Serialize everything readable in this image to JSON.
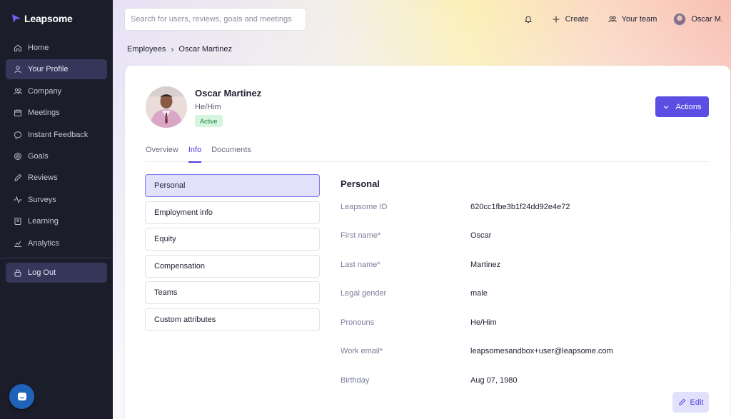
{
  "app": {
    "name": "Leapsome"
  },
  "sidebar": {
    "items": [
      {
        "label": "Home",
        "icon": "home-icon"
      },
      {
        "label": "Your Profile",
        "icon": "user-icon",
        "active": true
      },
      {
        "label": "Company",
        "icon": "users-icon"
      },
      {
        "label": "Meetings",
        "icon": "calendar-icon"
      },
      {
        "label": "Instant Feedback",
        "icon": "chat-bubble-icon"
      },
      {
        "label": "Goals",
        "icon": "target-icon"
      },
      {
        "label": "Reviews",
        "icon": "pen-icon"
      },
      {
        "label": "Surveys",
        "icon": "pulse-icon"
      },
      {
        "label": "Learning",
        "icon": "book-icon"
      },
      {
        "label": "Analytics",
        "icon": "chart-icon"
      }
    ],
    "logout": "Log Out"
  },
  "search": {
    "placeholder": "Search for users, reviews, goals and meetings"
  },
  "topbar": {
    "create": "Create",
    "team": "Your team",
    "user": "Oscar M."
  },
  "breadcrumb": {
    "parent": "Employees",
    "current": "Oscar Martinez"
  },
  "profile": {
    "name": "Oscar Martinez",
    "pronouns": "He/Him",
    "status": "Active",
    "actions_label": "Actions"
  },
  "tabs": [
    {
      "label": "Overview"
    },
    {
      "label": "Info",
      "active": true
    },
    {
      "label": "Documents"
    }
  ],
  "sections": [
    {
      "label": "Personal",
      "active": true
    },
    {
      "label": "Employment info"
    },
    {
      "label": "Equity"
    },
    {
      "label": "Compensation"
    },
    {
      "label": "Teams"
    },
    {
      "label": "Custom attributes"
    }
  ],
  "details": {
    "title": "Personal",
    "fields": [
      {
        "label": "Leapsome ID",
        "value": "620cc1fbe3b1f24dd92e4e72"
      },
      {
        "label": "First name*",
        "value": "Oscar"
      },
      {
        "label": "Last name*",
        "value": "Martinez"
      },
      {
        "label": "Legal gender",
        "value": "male"
      },
      {
        "label": "Pronouns",
        "value": "He/Him"
      },
      {
        "label": "Work email*",
        "value": "leapsomesandbox+user@leapsome.com"
      },
      {
        "label": "Birthday",
        "value": "Aug 07, 1980"
      }
    ],
    "edit_label": "Edit"
  },
  "colors": {
    "accent": "#5b4ee3",
    "sidebar_bg": "#1c1d2b",
    "active_badge": "#d6f5df"
  }
}
